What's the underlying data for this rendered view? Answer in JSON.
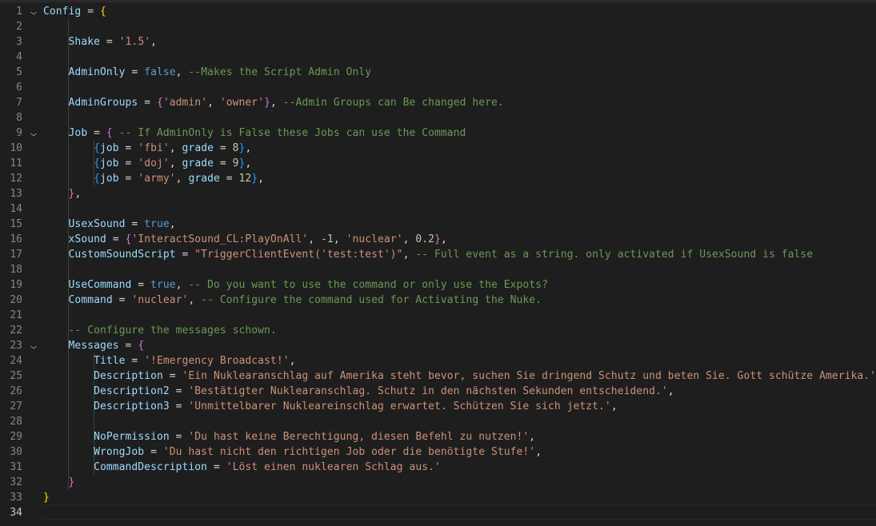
{
  "editor": {
    "language": "lua",
    "active_line": 34,
    "colors": {
      "background": "#1e1e1e",
      "variable": "#9cdcfe",
      "string": "#ce9178",
      "number": "#b5cea8",
      "keyword": "#569cd6",
      "comment": "#6a9955",
      "bracket_level_1": "#ffd700",
      "bracket_level_2": "#da70d6",
      "bracket_level_3": "#179fff"
    },
    "fold_icon": "chevron-down-icon",
    "fold_lines": [
      1,
      9,
      23
    ],
    "line_numbers": [
      "1",
      "2",
      "3",
      "4",
      "5",
      "6",
      "7",
      "8",
      "9",
      "10",
      "11",
      "12",
      "13",
      "14",
      "15",
      "16",
      "17",
      "18",
      "19",
      "20",
      "21",
      "22",
      "23",
      "24",
      "25",
      "26",
      "27",
      "28",
      "29",
      "30",
      "31",
      "32",
      "33",
      "34"
    ],
    "lines": [
      [
        [
          "var",
          "Config"
        ],
        [
          "op",
          " = "
        ],
        [
          "b1",
          "{"
        ]
      ],
      [],
      [
        [
          "op",
          "    "
        ],
        [
          "var",
          "Shake"
        ],
        [
          "op",
          " = "
        ],
        [
          "str",
          "'1.5'"
        ],
        [
          "op",
          ","
        ]
      ],
      [],
      [
        [
          "op",
          "    "
        ],
        [
          "var",
          "AdminOnly"
        ],
        [
          "op",
          " = "
        ],
        [
          "kw",
          "false"
        ],
        [
          "op",
          ", "
        ],
        [
          "com",
          "--Makes the Script Admin Only"
        ]
      ],
      [],
      [
        [
          "op",
          "    "
        ],
        [
          "var",
          "AdminGroups"
        ],
        [
          "op",
          " = "
        ],
        [
          "b2",
          "{"
        ],
        [
          "str",
          "'admin'"
        ],
        [
          "op",
          ", "
        ],
        [
          "str",
          "'owner'"
        ],
        [
          "b2",
          "}"
        ],
        [
          "op",
          ", "
        ],
        [
          "com",
          "--Admin Groups can Be changed here."
        ]
      ],
      [],
      [
        [
          "op",
          "    "
        ],
        [
          "var",
          "Job"
        ],
        [
          "op",
          " = "
        ],
        [
          "b2",
          "{"
        ],
        [
          "op",
          " "
        ],
        [
          "com",
          "-- If AdminOnly is False these Jobs can use the Command"
        ]
      ],
      [
        [
          "op",
          "        "
        ],
        [
          "b3",
          "{"
        ],
        [
          "var",
          "job"
        ],
        [
          "op",
          " = "
        ],
        [
          "str",
          "'fbi'"
        ],
        [
          "op",
          ", "
        ],
        [
          "var",
          "grade"
        ],
        [
          "op",
          " = "
        ],
        [
          "num",
          "8"
        ],
        [
          "b3",
          "}"
        ],
        [
          "op",
          ","
        ]
      ],
      [
        [
          "op",
          "        "
        ],
        [
          "b3",
          "{"
        ],
        [
          "var",
          "job"
        ],
        [
          "op",
          " = "
        ],
        [
          "str",
          "'doj'"
        ],
        [
          "op",
          ", "
        ],
        [
          "var",
          "grade"
        ],
        [
          "op",
          " = "
        ],
        [
          "num",
          "9"
        ],
        [
          "b3",
          "}"
        ],
        [
          "op",
          ","
        ]
      ],
      [
        [
          "op",
          "        "
        ],
        [
          "b3",
          "{"
        ],
        [
          "var",
          "job"
        ],
        [
          "op",
          " = "
        ],
        [
          "str",
          "'army'"
        ],
        [
          "op",
          ", "
        ],
        [
          "var",
          "grade"
        ],
        [
          "op",
          " = "
        ],
        [
          "num",
          "12"
        ],
        [
          "b3",
          "}"
        ],
        [
          "op",
          ","
        ]
      ],
      [
        [
          "op",
          "    "
        ],
        [
          "b2",
          "}"
        ],
        [
          "op",
          ","
        ]
      ],
      [],
      [
        [
          "op",
          "    "
        ],
        [
          "var",
          "UsexSound"
        ],
        [
          "op",
          " = "
        ],
        [
          "kw",
          "true"
        ],
        [
          "op",
          ","
        ]
      ],
      [
        [
          "op",
          "    "
        ],
        [
          "var",
          "xSound"
        ],
        [
          "op",
          " = "
        ],
        [
          "b2",
          "{"
        ],
        [
          "str",
          "'InteractSound_CL:PlayOnAll'"
        ],
        [
          "op",
          ", "
        ],
        [
          "num",
          "-1"
        ],
        [
          "op",
          ", "
        ],
        [
          "str",
          "'nuclear'"
        ],
        [
          "op",
          ", "
        ],
        [
          "num",
          "0.2"
        ],
        [
          "b2",
          "}"
        ],
        [
          "op",
          ","
        ]
      ],
      [
        [
          "op",
          "    "
        ],
        [
          "var",
          "CustomSoundScript"
        ],
        [
          "op",
          " = "
        ],
        [
          "str",
          "\"TriggerClientEvent('test:test')\""
        ],
        [
          "op",
          ", "
        ],
        [
          "com",
          "-- Full event as a string. only activated if UsexSound is false"
        ]
      ],
      [],
      [
        [
          "op",
          "    "
        ],
        [
          "var",
          "UseCommand"
        ],
        [
          "op",
          " = "
        ],
        [
          "kw",
          "true"
        ],
        [
          "op",
          ", "
        ],
        [
          "com",
          "-- Do you want to use the command or only use the Expots?"
        ]
      ],
      [
        [
          "op",
          "    "
        ],
        [
          "var",
          "Command"
        ],
        [
          "op",
          " = "
        ],
        [
          "str",
          "'nuclear'"
        ],
        [
          "op",
          ", "
        ],
        [
          "com",
          "-- Configure the command used for Activating the Nuke."
        ]
      ],
      [],
      [
        [
          "op",
          "    "
        ],
        [
          "com",
          "-- Configure the messages schown."
        ]
      ],
      [
        [
          "op",
          "    "
        ],
        [
          "var",
          "Messages"
        ],
        [
          "op",
          " = "
        ],
        [
          "b2",
          "{"
        ]
      ],
      [
        [
          "op",
          "        "
        ],
        [
          "var",
          "Title"
        ],
        [
          "op",
          " = "
        ],
        [
          "str",
          "'!Emergency Broadcast!'"
        ],
        [
          "op",
          ","
        ]
      ],
      [
        [
          "op",
          "        "
        ],
        [
          "var",
          "Description"
        ],
        [
          "op",
          " = "
        ],
        [
          "str",
          "'Ein Nuklearanschlag auf Amerika steht bevor, suchen Sie dringend Schutz und beten Sie. Gott schütze Amerika.'"
        ],
        [
          "op",
          ","
        ]
      ],
      [
        [
          "op",
          "        "
        ],
        [
          "var",
          "Description2"
        ],
        [
          "op",
          " = "
        ],
        [
          "str",
          "'Bestätigter Nuklearanschlag. Schutz in den nächsten Sekunden entscheidend.'"
        ],
        [
          "op",
          ","
        ]
      ],
      [
        [
          "op",
          "        "
        ],
        [
          "var",
          "Description3"
        ],
        [
          "op",
          " = "
        ],
        [
          "str",
          "'Unmittelbarer Nukleareinschlag erwartet. Schützen Sie sich jetzt.'"
        ],
        [
          "op",
          ","
        ]
      ],
      [],
      [
        [
          "op",
          "        "
        ],
        [
          "var",
          "NoPermission"
        ],
        [
          "op",
          " = "
        ],
        [
          "str",
          "'Du hast keine Berechtigung, diesen Befehl zu nutzen!'"
        ],
        [
          "op",
          ","
        ]
      ],
      [
        [
          "op",
          "        "
        ],
        [
          "var",
          "WrongJob"
        ],
        [
          "op",
          " = "
        ],
        [
          "str",
          "'Du hast nicht den richtigen Job oder die benötigte Stufe!'"
        ],
        [
          "op",
          ","
        ]
      ],
      [
        [
          "op",
          "        "
        ],
        [
          "var",
          "CommandDescription"
        ],
        [
          "op",
          " = "
        ],
        [
          "str",
          "'Löst einen nuklearen Schlag aus.'"
        ]
      ],
      [
        [
          "op",
          "    "
        ],
        [
          "b2",
          "}"
        ]
      ],
      [
        [
          "b1",
          "}"
        ]
      ],
      []
    ]
  }
}
